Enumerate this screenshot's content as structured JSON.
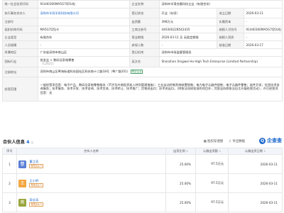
{
  "info": {
    "row1": {
      "credit_code_label": "统一社会信用代码",
      "credit_code": "91440300MA5G7Q5U4J",
      "name_label": "企业名称",
      "name": "深圳市羊滑合晨科技企业（有限合伙）"
    },
    "row2": {
      "partner_label": "执行事务合伙人",
      "partner": "深圳市羊耳羊耳科技有限公司",
      "status_label": "登记状态",
      "status": "开业（存续）",
      "est_date_label": "成立日期",
      "est_date": "2026-03-11"
    },
    "row3": {
      "reg_no_label": "注册号",
      "capital_label": "出资额",
      "capital": "398万元",
      "paid_label": "实缴资本",
      "paid": "-"
    },
    "row4": {
      "org_code_label": "组织机构代码",
      "org_code": "MA5G7Q5J-4",
      "biz_reg_label": "工商注册号",
      "biz_reg": "440300228542435",
      "tax_label": "纳税人识别号",
      "tax_no": "91440300MA5G7Q5U4J"
    },
    "row5": {
      "type_label": "企业类型",
      "type": "有限合伙",
      "term_label": "营业期限",
      "term": "2026-03-11 至 无固定期限",
      "tax_qual_label": "纳税人资质",
      "tax_qual": "-"
    },
    "row6": {
      "staff_label": "人员规模",
      "staff": "-",
      "insured_label": "参保人数",
      "insured": "-",
      "approved_label": "核准日期",
      "approved": "2026-03-17"
    },
    "row7": {
      "region_label": "所属地区",
      "region": "广东省深圳市南山区",
      "authority_label": "登记机关",
      "authority": "深圳市市场监督管理局"
    },
    "row8": {
      "industry_label": "国标行业",
      "industry": "批发业 > 数码及家电零售",
      "industry_sub": "（C2621）",
      "en_name_label": "英文名",
      "en_name": "Shenzhen Xingwei He High Tech Enterprise (Limited Partnership)"
    },
    "row9": {
      "address_label": "注册地址",
      "address": "深圳市南山区粤海街道科技园社区科技南十二路18号（粤广路201）",
      "nearby_tag": "附近企业"
    },
    "row10": {
      "scope_label": "经营范围",
      "scope": "一般经营项目是：电子产品、数码及家电零售服务（不涉及外商投资准入特别管理措施）；工业自动控制系统装置销售；电力电子元器件销售；电子元器件零售；软件开发；信息技术咨询服务；技术服务、技术开发、技术咨询、技术交流、技术转让、技术推广；货物进出口；技术进出口。（除依法须经批准的项目外，凭营业执照依法自主开展经营活动），许可经营项目是：无"
    }
  },
  "partners": {
    "title": "合伙人信息",
    "count": "4",
    "tool_search": "股权穿透图",
    "tool_export": "导出数据",
    "logo_text": "企查查",
    "headers": {
      "index": "序号",
      "name": "合伙人名称",
      "ratio": "出资比例",
      "amount": "认缴出资额",
      "date": "认缴出资日期"
    },
    "rows": [
      {
        "index": "1",
        "avatar": "曹",
        "avatar_color": "#5b7fd6",
        "name": "曹江涛",
        "tag": "有限合伙人",
        "ratio": "25.00%",
        "amount": "97.5万元",
        "date": "2026-03-11"
      },
      {
        "index": "2",
        "avatar": "王",
        "avatar_color": "#f2a640",
        "name": "王小明",
        "tag": "有限合伙人",
        "ratio": "25.00%",
        "amount": "97.5万元",
        "date": "2026-03-11"
      },
      {
        "index": "3",
        "avatar": "蒋",
        "avatar_color": "#9aa53c",
        "name": "蒋佳涛",
        "tag": "有限合伙人",
        "ratio": "25.00%",
        "amount": "97.5万元",
        "date": "2026-03-11"
      }
    ]
  }
}
